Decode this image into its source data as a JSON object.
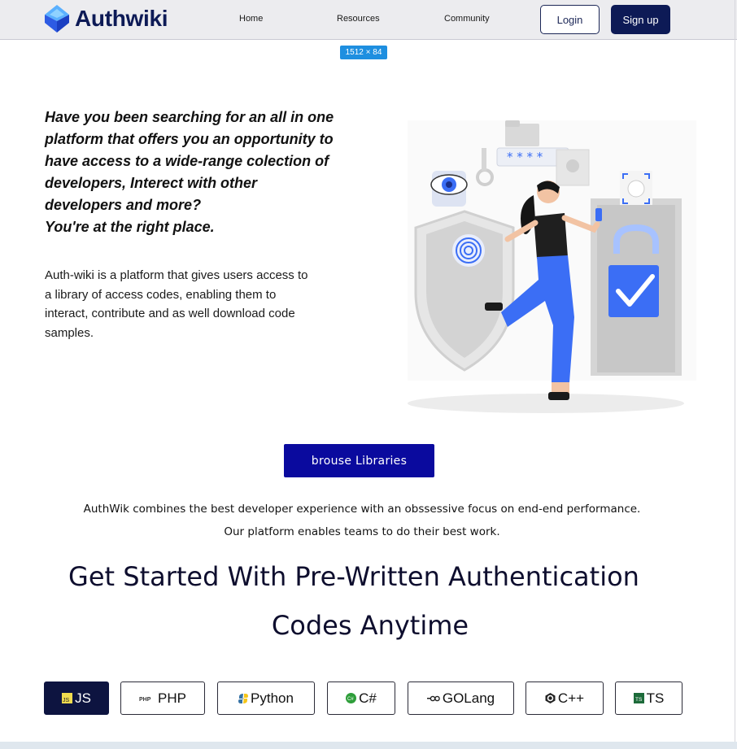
{
  "header": {
    "brand": "Authwiki",
    "nav": [
      "Home",
      "Resources",
      "Community"
    ],
    "login_label": "Login",
    "signup_label": "Sign up"
  },
  "dimension_badge": "1512 × 84",
  "hero": {
    "question_lines": [
      "Have you been searching for an all in one",
      "platform that offers you an opportunity to",
      "have access to a wide-range colection of",
      "developers, Interect with other",
      "developers and more?",
      "You're at the right place."
    ],
    "description_lines": [
      "Auth-wiki is a platform that gives users access to",
      "a library of access codes, enabling them to",
      "interact, contribute and as well download code",
      "samples."
    ],
    "password_mask": "* * * *"
  },
  "browse_label": "brouse Libraries",
  "tagline_lines": [
    "AuthWik combines the best developer experience with an obssessive focus on end-end performance.",
    "Our platform enables teams to do their best work."
  ],
  "headline_lines": [
    "Get Started With Pre-Written Authentication",
    "Codes Anytime"
  ],
  "languages": [
    {
      "label": "JS",
      "icon": "js-icon",
      "active": true,
      "badge": "JS"
    },
    {
      "label": "PHP",
      "icon": "php-icon",
      "active": false,
      "badge": "PHP"
    },
    {
      "label": "Python",
      "icon": "python-icon",
      "active": false
    },
    {
      "label": "C#",
      "icon": "csharp-icon",
      "active": false,
      "badge": "C#"
    },
    {
      "label": "GOLang",
      "icon": "golang-icon",
      "active": false
    },
    {
      "label": "C++",
      "icon": "cpp-icon",
      "active": false
    },
    {
      "label": "TS",
      "icon": "ts-icon",
      "active": false,
      "badge": "TS"
    }
  ],
  "colors": {
    "brand_navy": "#0d1a56",
    "browse_button": "#0a0a9e",
    "illustration_blue": "#3b6ef5"
  }
}
